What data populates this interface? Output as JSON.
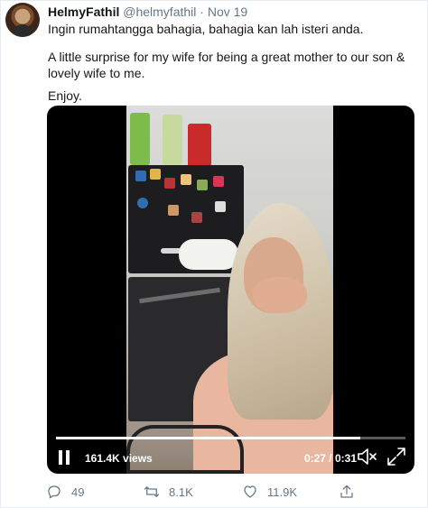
{
  "tweet": {
    "display_name": "HelmyFathil",
    "handle": "@helmyfathil",
    "separator": "·",
    "date": "Nov 19",
    "text_line1": "Ingin rumahtangga bahagia, bahagia kan lah isteri anda.",
    "text_line2": "A little surprise for my wife for being a great mother to our son & lovely wife to me.",
    "text_line3": "Enjoy."
  },
  "video": {
    "views": "161.4K views",
    "time": "0:27 / 0:31",
    "progress_fraction": 0.87
  },
  "actions": {
    "reply_count": "49",
    "retweet_count": "8.1K",
    "like_count": "11.9K"
  },
  "colors": {
    "secondary_text": "#657786",
    "primary_text": "#14171a",
    "border": "#e6ecf0"
  },
  "icons": {
    "reply": "reply-icon",
    "retweet": "retweet-icon",
    "like": "heart-icon",
    "share": "share-icon",
    "pause": "pause-icon",
    "mute": "volume-muted-icon",
    "fullscreen": "fullscreen-icon"
  }
}
